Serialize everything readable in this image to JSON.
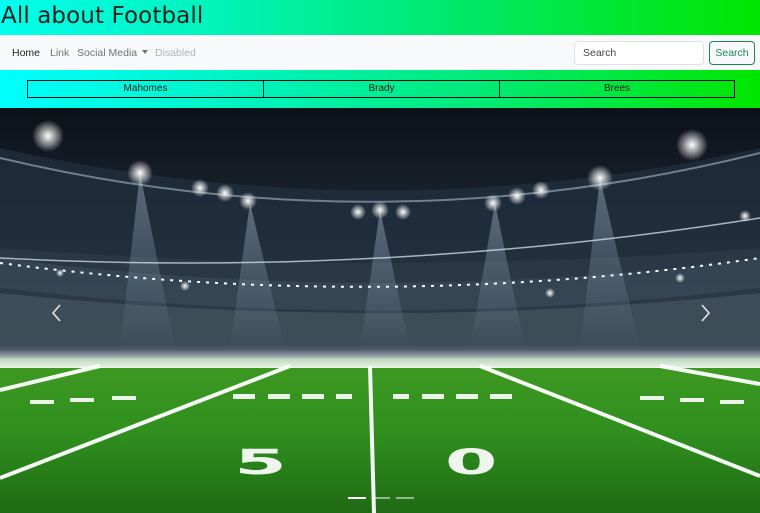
{
  "header": {
    "title": "All about Football"
  },
  "navbar": {
    "links": [
      {
        "label": "Home",
        "state": "active"
      },
      {
        "label": "Link",
        "state": "normal"
      },
      {
        "label": "Social Media",
        "state": "dropdown"
      },
      {
        "label": "Disabled",
        "state": "disabled"
      }
    ],
    "search": {
      "placeholder": "Search",
      "button_label": "Search"
    }
  },
  "players": [
    "Mahomes",
    "Brady",
    "Brees"
  ],
  "carousel": {
    "image": "football-stadium-50-yard-line",
    "field_number_left": "5",
    "field_number_right": "0",
    "slide_count": 3,
    "active_slide": 1,
    "prev_icon": "chevron-left-icon",
    "next_icon": "chevron-right-icon"
  },
  "colors": {
    "header_gradient": [
      "#00ffee",
      "#00e600"
    ],
    "navbar_bg": "#f8f9fa",
    "search_button": "#198754",
    "field_green": "#2f8e1e"
  }
}
